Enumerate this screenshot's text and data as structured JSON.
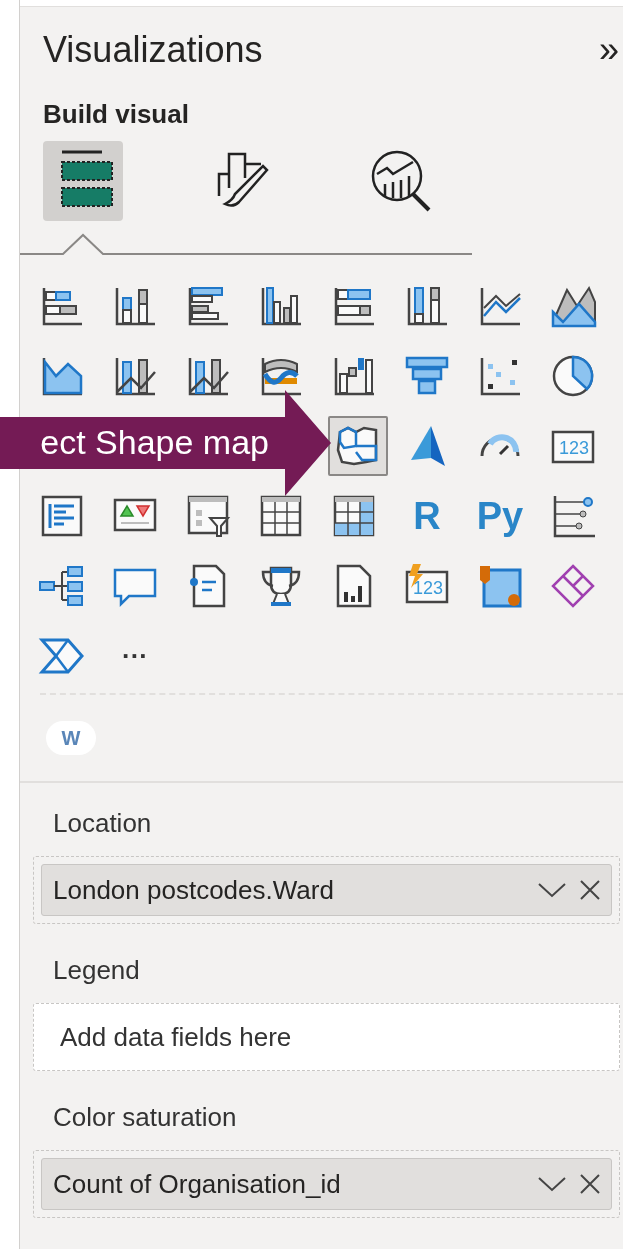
{
  "pane": {
    "title": "Visualizations",
    "collapse_glyph": "»"
  },
  "build": {
    "heading": "Build visual",
    "tabs": [
      {
        "kind": "fields",
        "selected": true
      },
      {
        "kind": "format",
        "selected": false
      },
      {
        "kind": "analytics",
        "selected": false
      }
    ]
  },
  "visuals": [
    {
      "kind": "bar-stacked",
      "selected": false
    },
    {
      "kind": "column-stacked",
      "selected": false
    },
    {
      "kind": "bar-clustered",
      "selected": false
    },
    {
      "kind": "column-clustered",
      "selected": false
    },
    {
      "kind": "bar-100",
      "selected": false
    },
    {
      "kind": "column-100",
      "selected": false
    },
    {
      "kind": "line",
      "selected": false
    },
    {
      "kind": "area-stacked",
      "selected": false
    },
    {
      "kind": "area",
      "selected": false
    },
    {
      "kind": "line-column",
      "selected": false
    },
    {
      "kind": "line-column",
      "selected": false
    },
    {
      "kind": "ribbon",
      "selected": false
    },
    {
      "kind": "waterfall",
      "selected": false
    },
    {
      "kind": "funnel",
      "selected": false
    },
    {
      "kind": "scatter",
      "selected": false
    },
    {
      "kind": "pie",
      "selected": false
    },
    {
      "kind": "hidden"
    },
    {
      "kind": "hidden"
    },
    {
      "kind": "hidden"
    },
    {
      "kind": "hidden"
    },
    {
      "kind": "shape-map",
      "selected": true
    },
    {
      "kind": "azure-map",
      "selected": false
    },
    {
      "kind": "gauge",
      "selected": false
    },
    {
      "kind": "card",
      "label": "123",
      "selected": false
    },
    {
      "kind": "multi-row-card",
      "selected": false
    },
    {
      "kind": "kpi",
      "selected": false
    },
    {
      "kind": "slicer",
      "selected": false
    },
    {
      "kind": "table",
      "selected": false
    },
    {
      "kind": "matrix",
      "selected": false
    },
    {
      "kind": "letter",
      "label": "R",
      "selected": false
    },
    {
      "kind": "letter",
      "label": "Py",
      "selected": false
    },
    {
      "kind": "key-influencers",
      "selected": false
    },
    {
      "kind": "decomposition-tree",
      "selected": false
    },
    {
      "kind": "speech-bubble",
      "selected": false
    },
    {
      "kind": "narrative",
      "selected": false
    },
    {
      "kind": "trophy",
      "selected": false
    },
    {
      "kind": "paginated",
      "selected": false
    },
    {
      "kind": "card-new",
      "label": "123",
      "selected": false
    },
    {
      "kind": "arcgis",
      "selected": false
    },
    {
      "kind": "power-apps",
      "selected": false
    },
    {
      "kind": "power-automate",
      "selected": false
    },
    {
      "kind": "more",
      "label": "···",
      "selected": false
    }
  ],
  "custom_visual": {
    "label": "W"
  },
  "wells": [
    {
      "label": "Location",
      "kind": "filled",
      "value": "London postcodes.Ward"
    },
    {
      "label": "Legend",
      "kind": "empty",
      "placeholder": "Add data fields here"
    },
    {
      "label": "Color saturation",
      "kind": "filled",
      "value": "Count of Organisation_id"
    }
  ],
  "callout": {
    "text": "ect Shape map"
  }
}
